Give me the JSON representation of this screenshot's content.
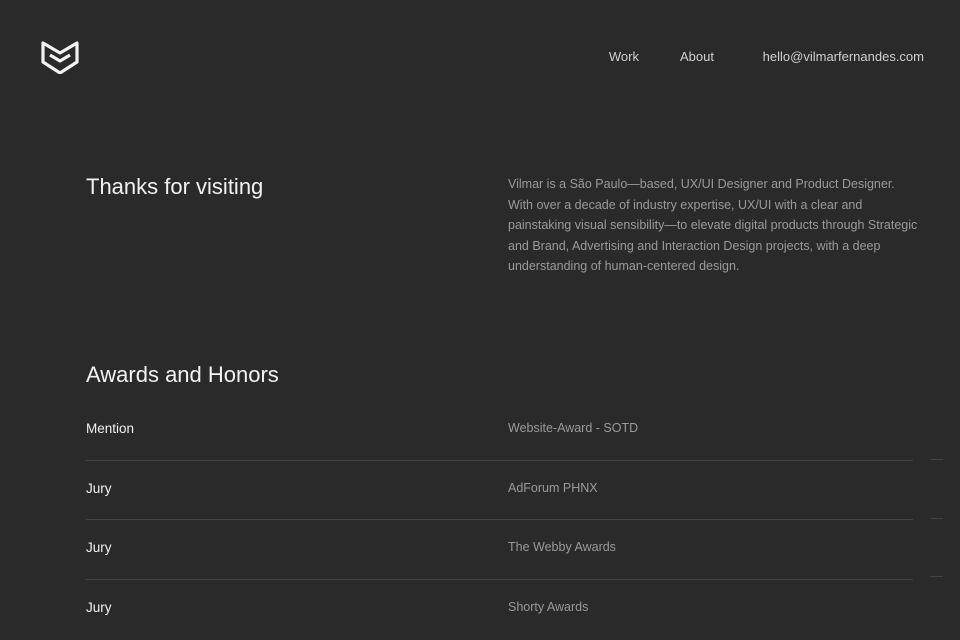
{
  "header": {
    "logo_icon": "shield-chevron-logo",
    "nav": {
      "work": "Work",
      "about": "About",
      "email": "hello@vilmarfernandes.com"
    }
  },
  "intro": {
    "title": "Thanks for visiting",
    "text": "Vilmar is a São Paulo—based, UX/UI Designer and Product Designer. With over a decade of industry expertise, UX/UI with a clear and painstaking visual sensibility—to elevate digital products through Strategic and Brand, Advertising and Interaction Design projects, with a deep understanding of human-centered design."
  },
  "awards": {
    "title": "Awards and Honors",
    "items": [
      {
        "role": "Mention",
        "name": "Website-Award - SOTD"
      },
      {
        "role": "Jury",
        "name": "AdForum PHNX"
      },
      {
        "role": "Jury",
        "name": "The Webby Awards"
      },
      {
        "role": "Jury",
        "name": "Shorty Awards"
      }
    ]
  },
  "colors": {
    "background": "#2a2a2a",
    "heading": "#f2f2f2",
    "muted": "#9a9a9a",
    "divider": "#444444"
  }
}
